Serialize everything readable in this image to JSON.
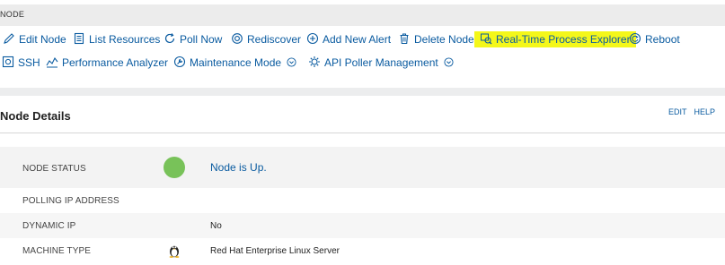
{
  "node_section": {
    "header": "NODE",
    "toolbar_row1": [
      {
        "label": "Edit Node",
        "icon": "pencil-icon"
      },
      {
        "label": "List Resources",
        "icon": "document-list-icon"
      },
      {
        "label": "Poll Now",
        "icon": "refresh-icon"
      },
      {
        "label": "Rediscover",
        "icon": "rediscover-icon"
      },
      {
        "label": "Add New Alert",
        "icon": "plus-circle-icon"
      },
      {
        "label": "Delete Node",
        "icon": "trash-icon"
      },
      {
        "label": "Real-Time Process Explorer",
        "icon": "process-explorer-icon",
        "highlighted": true
      },
      {
        "label": "Reboot",
        "icon": "reboot-icon"
      }
    ],
    "toolbar_row2": [
      {
        "label": "SSH",
        "icon": "ssh-icon"
      },
      {
        "label": "Performance Analyzer",
        "icon": "performance-analyzer-icon"
      },
      {
        "label": "Maintenance Mode",
        "icon": "maintenance-icon",
        "dropdown": true
      },
      {
        "label": "API Poller Management",
        "icon": "api-poller-icon",
        "dropdown": true
      }
    ],
    "highlight_color": "#f4f71a"
  },
  "details": {
    "title": "Node Details",
    "actions": {
      "edit": "EDIT",
      "help": "HELP"
    },
    "rows": {
      "node_status": {
        "label": "NODE STATUS",
        "value": "Node is Up.",
        "status_color": "#78c259"
      },
      "polling_ip": {
        "label": "POLLING IP ADDRESS",
        "value": ""
      },
      "dynamic_ip": {
        "label": "DYNAMIC IP",
        "value": "No"
      },
      "machine_type": {
        "label": "MACHINE TYPE",
        "value": "Red Hat Enterprise Linux Server",
        "icon": "linux-penguin-icon"
      }
    }
  },
  "colors": {
    "link": "#0a5ba0",
    "background": "#ecedee"
  }
}
